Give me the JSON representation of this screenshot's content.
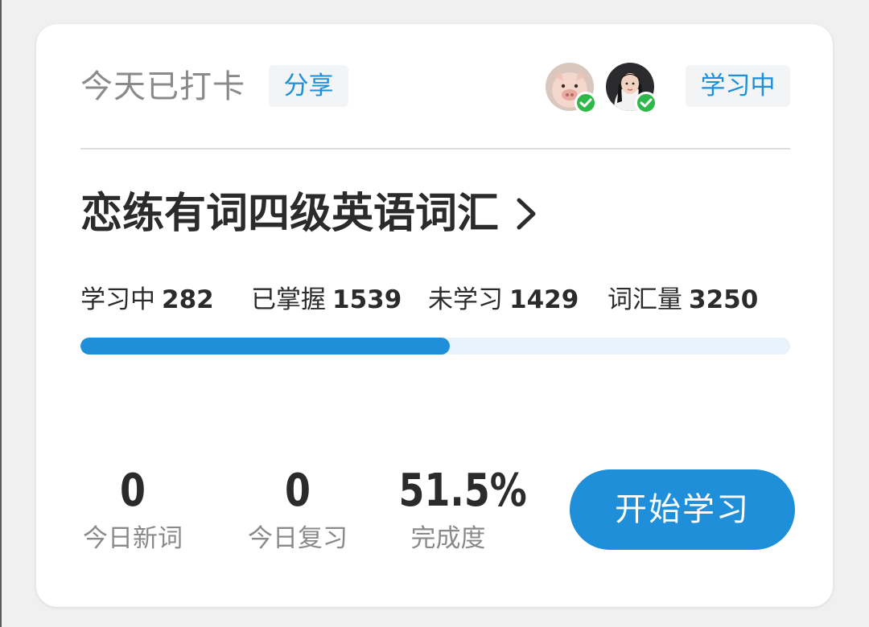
{
  "header": {
    "checkin_label": "今天已打卡",
    "share_label": "分享",
    "status_label": "学习中"
  },
  "avatars": [
    {
      "name": "pig-avatar",
      "checked": true
    },
    {
      "name": "girl-avatar",
      "checked": true
    }
  ],
  "book": {
    "title": "恋练有词四级英语词汇"
  },
  "stats": [
    {
      "label": "学习中",
      "value": "282"
    },
    {
      "label": "已掌握",
      "value": "1539"
    },
    {
      "label": "未学习",
      "value": "1429"
    },
    {
      "label": "词汇量",
      "value": "3250"
    }
  ],
  "progress": {
    "fraction": 0.52
  },
  "metrics": [
    {
      "value": "0",
      "label": "今日新词"
    },
    {
      "value": "0",
      "label": "今日复习"
    },
    {
      "value": "51.5%",
      "label": "完成度"
    }
  ],
  "start_button_label": "开始学习",
  "colors": {
    "accent": "#1e8fd8",
    "progress_track": "#e8f3fb",
    "check": "#2fb84a",
    "chip_bg": "#f2f4f5"
  },
  "icons": {
    "book_arrow": "chevron-right-icon",
    "badge": "check-icon"
  }
}
